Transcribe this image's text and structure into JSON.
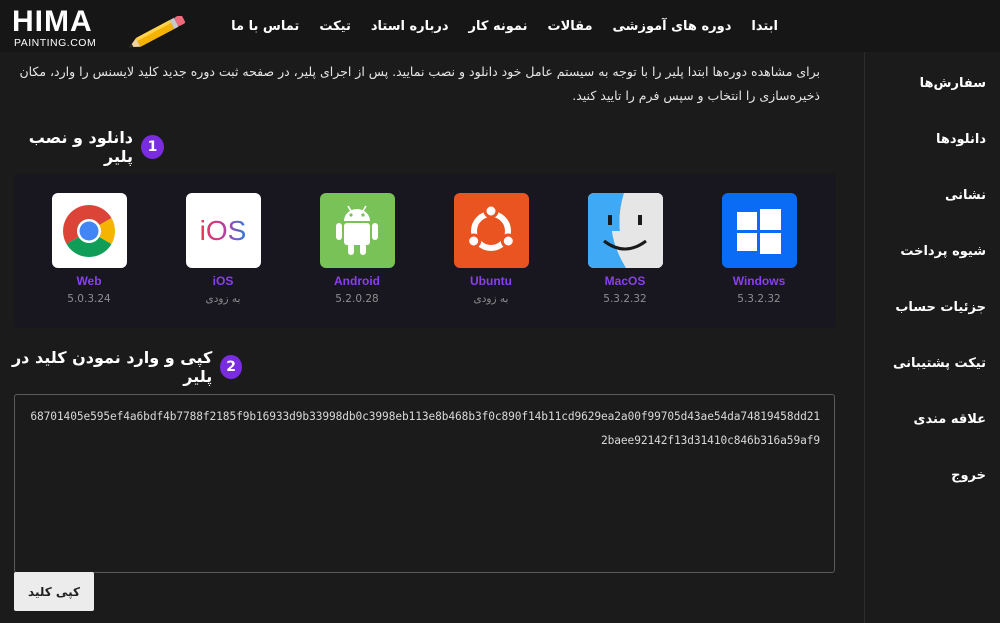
{
  "logo": {
    "main": "HIMA",
    "sub": "PAINTING.COM"
  },
  "nav": [
    "ابتدا",
    "دوره های آموزشی",
    "مقالات",
    "نمونه کار",
    "درباره استاد",
    "تیکت",
    "تماس با ما"
  ],
  "sidebar": [
    "سفارش‌ها",
    "دانلودها",
    "نشانی",
    "شیوه پرداخت",
    "جزئیات حساب",
    "تیکت پشتیبانی",
    "علاقه مندی",
    "خروج"
  ],
  "intro": "برای مشاهده دوره‌ها ابتدا پلیر را با توجه به سیستم عامل خود دانلود و نصب نمایید. پس از اجرای پلیر، در صفحه ثبت دوره جدید کلید لایسنس را وارد، مکان ذخیره‌سازی را انتخاب و سپس فرم را تایید کنید.",
  "step1": {
    "num": "1",
    "title": "دانلود و نصب پلیر"
  },
  "step2": {
    "num": "2",
    "title": "کپی و وارد نمودن کلید در پلیر"
  },
  "platforms": [
    {
      "name": "Windows",
      "version": "5.3.2.32",
      "icon": "windows-icon",
      "color": "#0a6cf5"
    },
    {
      "name": "MacOS",
      "version": "5.3.2.32",
      "icon": "finder-icon",
      "color": "#3fa9f5"
    },
    {
      "name": "Ubuntu",
      "version": "به زودی",
      "icon": "ubuntu-icon",
      "color": "#e95420"
    },
    {
      "name": "Android",
      "version": "5.2.0.28",
      "icon": "android-icon",
      "color": "#78c257"
    },
    {
      "name": "iOS",
      "version": "به زودی",
      "icon": "ios-icon",
      "color": "#ffffff"
    },
    {
      "name": "Web",
      "version": "5.0.3.24",
      "icon": "chrome-icon",
      "color": "#ffffff"
    }
  ],
  "license_key": "68701405e595ef4a6bdf4b7788f2185f9b16933d9b33998db0c3998eb113e8b468b3f0c890f14b11cd9629ea2a00f99705d43ae54da74819458dd212baee92142f13d31410c846b316a59af9",
  "copy_button": "کپی کلید"
}
